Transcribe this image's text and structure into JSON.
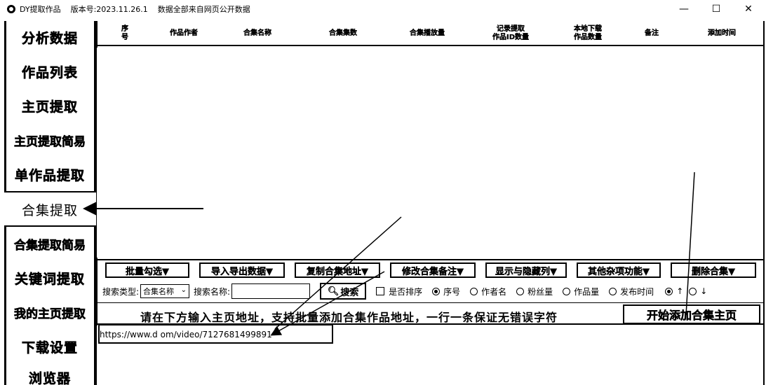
{
  "titlebar": {
    "app_name": "DY提取作品",
    "version": "版本号:2023.11.26.1",
    "note": "数据全部来自网页公开数据",
    "minimize": "—",
    "maximize": "☐",
    "close": "✕"
  },
  "sidebar": {
    "items": [
      {
        "label": "分析数据"
      },
      {
        "label": "作品列表"
      },
      {
        "label": "主页提取"
      },
      {
        "label": "主页提取简易"
      },
      {
        "label": "单作品提取"
      },
      {
        "label": "合集提取"
      },
      {
        "label": "合集提取简易"
      },
      {
        "label": "关键词提取"
      },
      {
        "label": "我的主页提取"
      },
      {
        "label": "下载设置"
      },
      {
        "label": "浏览器"
      }
    ],
    "active_index": 5
  },
  "table": {
    "columns": [
      {
        "label": "序\n号"
      },
      {
        "label": "作品作者"
      },
      {
        "label": "合集名称"
      },
      {
        "label": "合集集数"
      },
      {
        "label": "合集播放量"
      },
      {
        "label": "记录提取\n作品ID数量"
      },
      {
        "label": "本地下载\n作品数量"
      },
      {
        "label": "备注"
      },
      {
        "label": "添加时间"
      }
    ]
  },
  "toolbar": {
    "buttons": [
      {
        "label": "批量勾选▼"
      },
      {
        "label": "导入导出数据▼"
      },
      {
        "label": "复制合集地址▼"
      },
      {
        "label": "修改合集备注▼"
      },
      {
        "label": "显示与隐藏列▼"
      },
      {
        "label": "其他杂项功能▼"
      },
      {
        "label": "删除合集▼"
      }
    ]
  },
  "search": {
    "type_label": "搜索类型:",
    "type_value": "合集名称",
    "name_label": "搜索名称:",
    "name_value": "",
    "search_button": "搜索",
    "sort_checkbox_label": "是否排序",
    "sort_options": [
      {
        "label": "序号",
        "selected": true
      },
      {
        "label": "作者名",
        "selected": false
      },
      {
        "label": "粉丝量",
        "selected": false
      },
      {
        "label": "作品量",
        "selected": false
      },
      {
        "label": "发布时间",
        "selected": false
      }
    ],
    "order_asc": "↑",
    "order_desc": "↓"
  },
  "instruction": {
    "text": "请在下方输入主页地址，支持批量添加合集作品地址，一行一条保证无错误字符",
    "start_button": "开始添加合集主页"
  },
  "url_input": {
    "value": "https://www.d    om/video/7127681499891"
  }
}
